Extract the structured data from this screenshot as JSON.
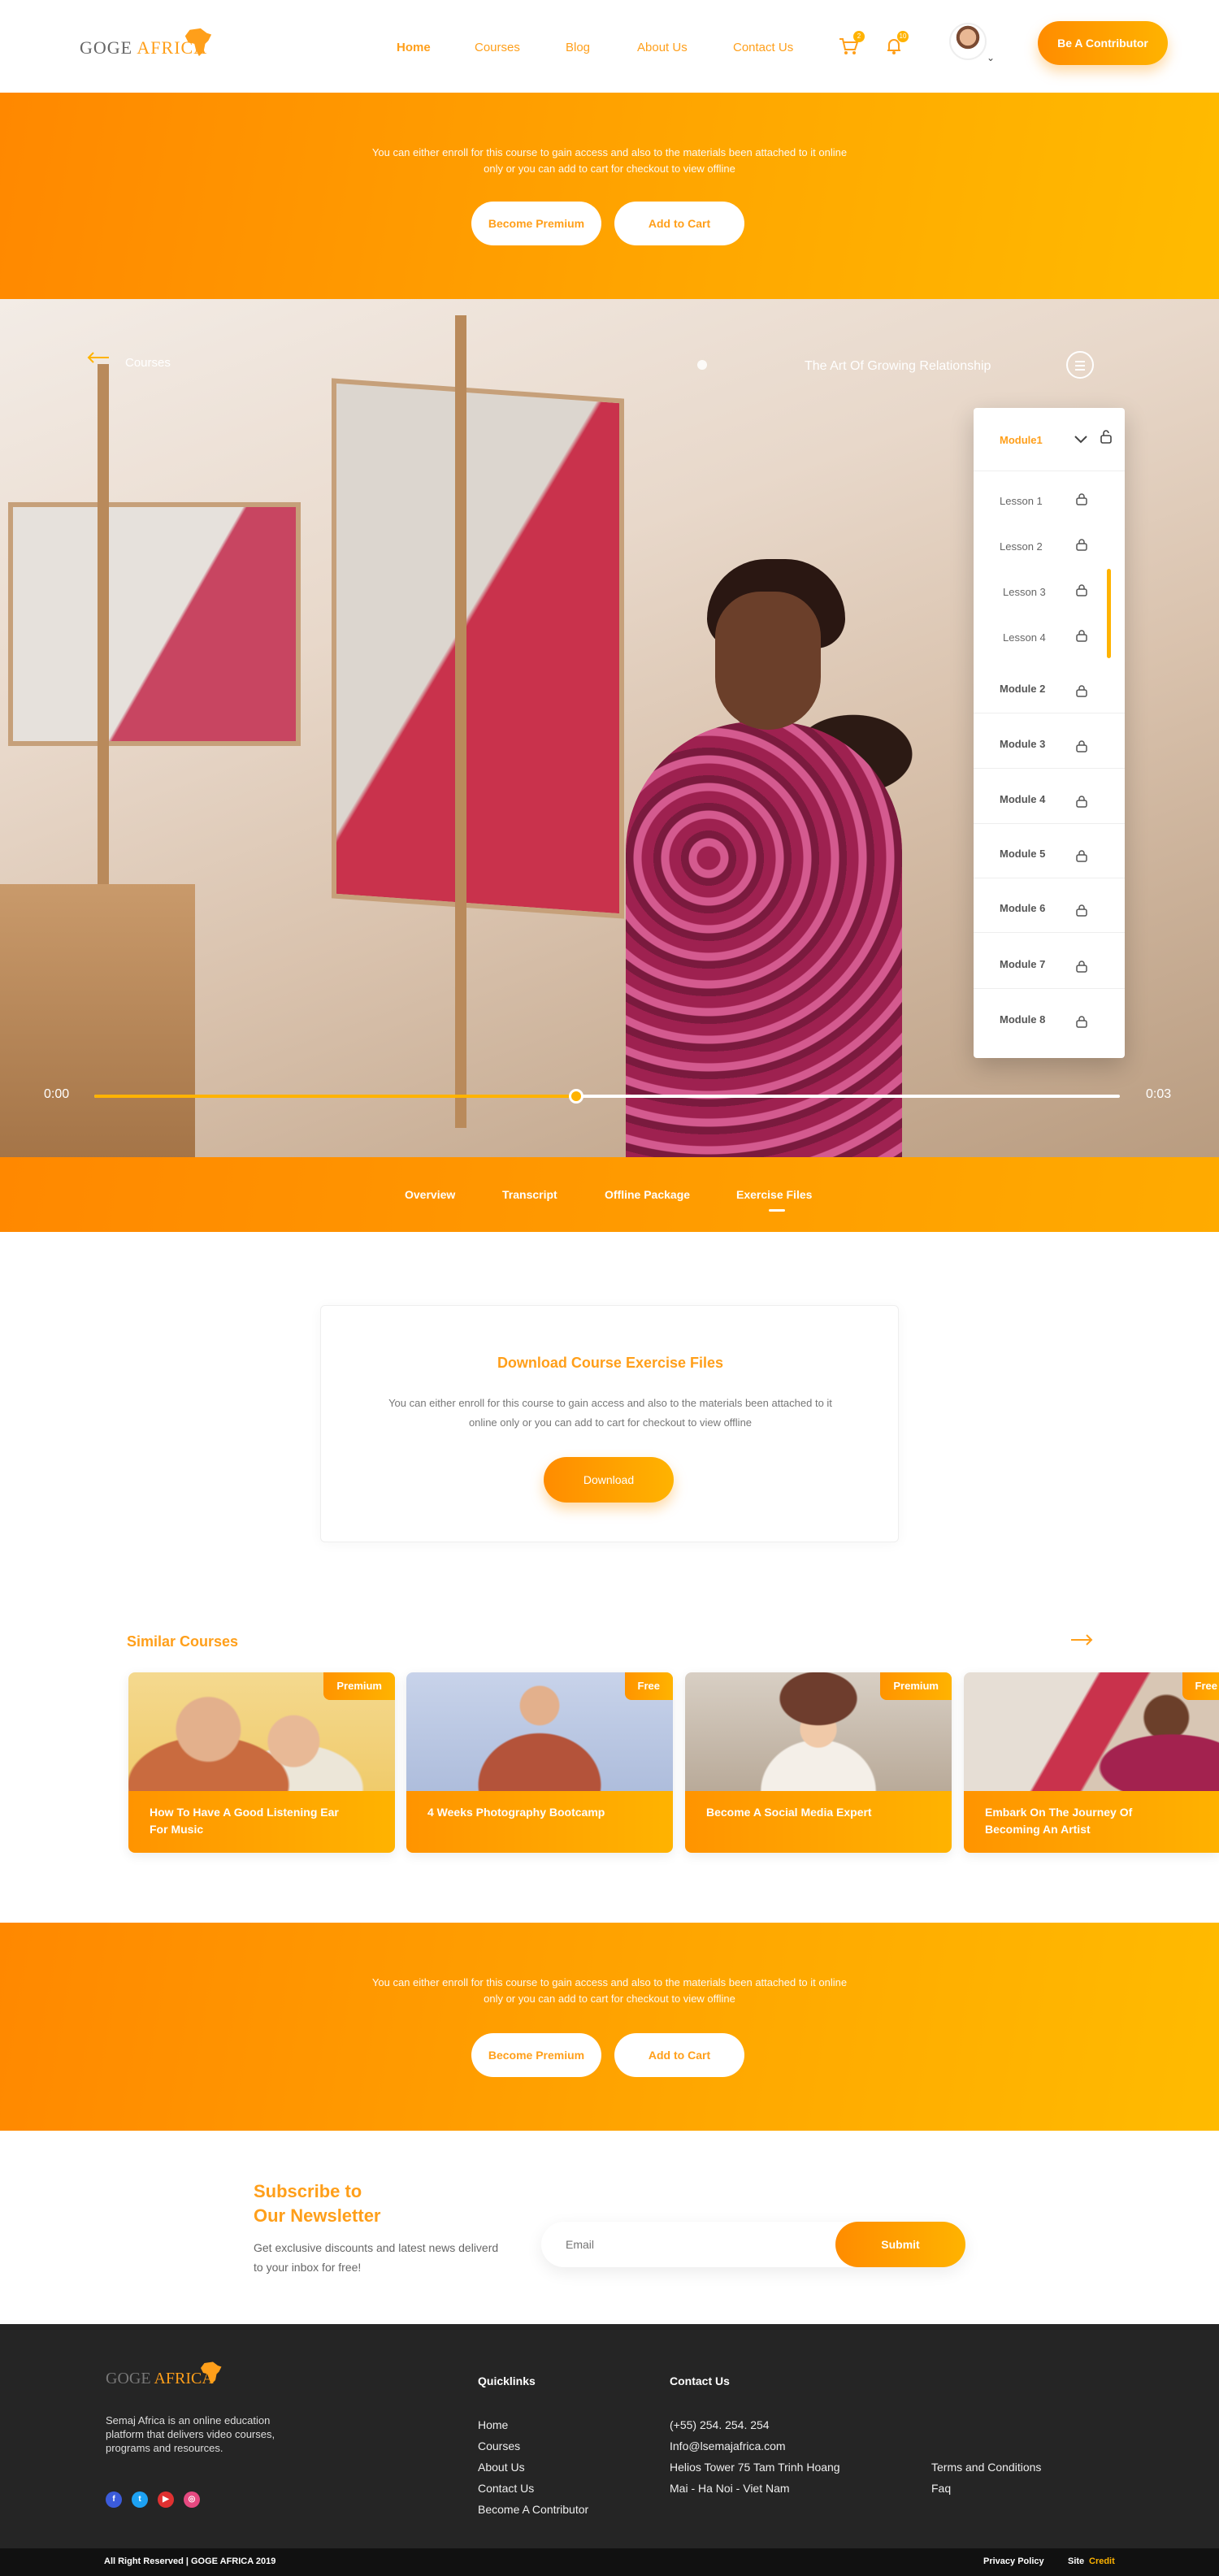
{
  "colors": {
    "accent": "#ff9f1a",
    "accent_light": "#ffb300",
    "footer_bg": "#252525"
  },
  "brand": {
    "name_part1": "GOGE ",
    "name_part2": "AFRICA"
  },
  "nav": {
    "links": [
      "Home",
      "Courses",
      "Blog",
      "About Us",
      "Contact Us"
    ],
    "active": "Home",
    "cart_badge": "2",
    "bell_badge": "10",
    "contributor_label": "Be A Contributor"
  },
  "top_banner": {
    "text": "You can either enroll for this course to gain access and also to the materials been attached to it online only or you can add to cart for checkout to view offline",
    "premium_label": "Become Premium",
    "cart_label": "Add to Cart"
  },
  "player": {
    "back_label": "Courses",
    "title": "The Art Of Growing Relationship",
    "time_current": "0:00",
    "time_total": "0:03",
    "progress": 0.47
  },
  "modules": {
    "open_module": "Module1",
    "lessons": [
      "Lesson 1",
      "Lesson 2",
      "Lesson 3",
      "Lesson 4"
    ],
    "others": [
      "Module 2",
      "Module 3",
      "Module 4",
      "Module 5",
      "Module 6",
      "Module 7",
      "Module 8"
    ]
  },
  "tabs": {
    "items": [
      "Overview",
      "Transcript",
      "Offline Package",
      "Exercise Files"
    ],
    "active": "Exercise Files"
  },
  "download": {
    "title": "Download Course Exercise Files",
    "text": "You can either enroll for this course to gain access and also to the materials been attached to it online only or you can add to cart for checkout to view offline",
    "button": "Download"
  },
  "similar": {
    "title": "Similar Courses",
    "courses": [
      {
        "name": "How To Have A Good Listening Ear For Music",
        "tag": "Premium"
      },
      {
        "name": "4 Weeks Photography Bootcamp",
        "tag": "Free"
      },
      {
        "name": "Become A Social Media Expert",
        "tag": "Premium"
      },
      {
        "name": "Embark On The Journey Of Becoming An Artist",
        "tag": "Free"
      }
    ]
  },
  "bottom_banner": {
    "text": "You can either enroll for this course to gain access and also to the materials been attached to it online only or you can add to cart for checkout to view offline",
    "premium_label": "Become Premium",
    "cart_label": "Add to Cart"
  },
  "newsletter": {
    "title_line1": "Subscribe to",
    "title_line2": "Our Newsletter",
    "text": "Get exclusive discounts and latest news deliverd to your inbox for free!",
    "email_placeholder": "Email",
    "submit_label": "Submit"
  },
  "footer": {
    "about": "Semaj Africa is an online education platform that delivers video courses, programs and resources.",
    "quicklinks_title": "Quicklinks",
    "quicklinks": [
      "Home",
      "Courses",
      "About Us",
      "Contact Us",
      "Become A Contributor"
    ],
    "contact_title": "Contact Us",
    "contact": [
      "(+55) 254. 254. 254",
      "Info@lsemajafrica.com",
      "Helios Tower 75 Tam Trinh Hoang",
      "Mai - Ha Noi - Viet Nam"
    ],
    "legal": [
      "Terms and Conditions",
      "Faq"
    ],
    "social": [
      "facebook-icon",
      "twitter-icon",
      "youtube-icon",
      "instagram-icon"
    ],
    "copyright": "All Right Reserved | GOGE AFRICA 2019",
    "privacy": "Privacy Policy",
    "site_label": "Site",
    "credit_label": "Credit"
  }
}
